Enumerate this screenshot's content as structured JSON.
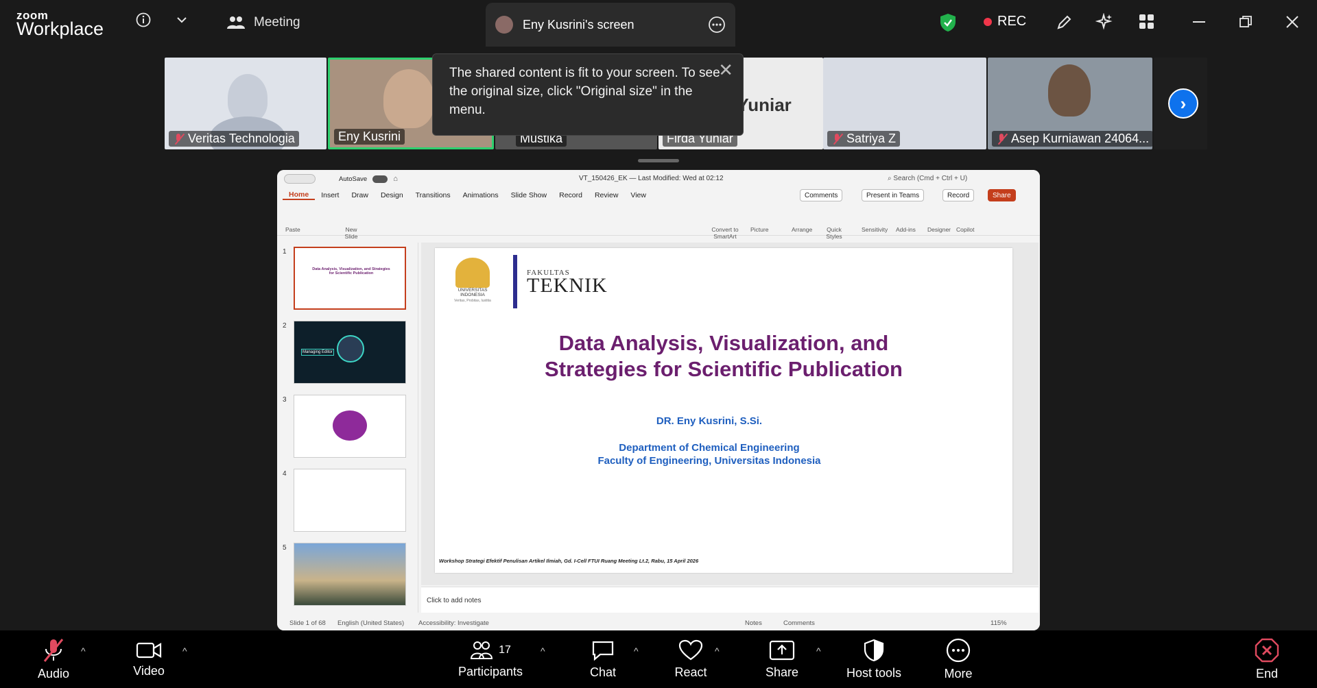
{
  "app": {
    "logo_top": "zoom",
    "logo_bottom": "Workplace"
  },
  "topbar": {
    "meeting_label": "Meeting",
    "screen_tab_label": "Eny Kusrini's screen",
    "rec_label": "REC"
  },
  "tooltip": {
    "text": "The shared content is fit to your screen. To see the original size, click \"Original size\" in the menu."
  },
  "participants_strip": [
    {
      "name": "Veritas Technologia"
    },
    {
      "name": "Eny Kusrini"
    },
    {
      "name": "Mustika"
    },
    {
      "name": "Firda Yuniar"
    },
    {
      "name": "Satriya Z"
    },
    {
      "name": "Asep Kurniawan 24064..."
    }
  ],
  "firda_big_name": "Firda Yuniar",
  "ppt": {
    "autosave": "AutoSave",
    "file_name": "VT_150426_EK",
    "last_modified": "— Last Modified: Wed at 02:12",
    "search": "Search (Cmd + Ctrl + U)",
    "menu": [
      "Home",
      "Insert",
      "Draw",
      "Design",
      "Transitions",
      "Animations",
      "Slide Show",
      "Record",
      "Review",
      "View"
    ],
    "buttons": {
      "comments": "Comments",
      "present_in_teams": "Present in Teams",
      "record": "Record",
      "share": "Share"
    },
    "ribbon": {
      "paste": "Paste",
      "new_slide": "New Slide",
      "convert": "Convert to SmartArt",
      "picture": "Picture",
      "arrange": "Arrange",
      "quick_styles": "Quick Styles",
      "sensitivity": "Sensitivity",
      "addins": "Add-ins",
      "designer": "Designer",
      "copilot": "Copilot"
    },
    "slide_numbers": [
      "1",
      "2",
      "3",
      "4",
      "5"
    ],
    "thumb2_text": "Managing Editor",
    "thumb1_title": "Data Analysis, Visualization, and Strategies for Scientific Publication",
    "slide": {
      "faculty_small": "FAKULTAS",
      "faculty_big": "TEKNIK",
      "univ": "UNIVERSITAS INDONESIA",
      "univ_motto": "Veritas, Probitas, Iustitia",
      "title_line1": "Data Analysis, Visualization, and",
      "title_line2": "Strategies for Scientific Publication",
      "author": "DR. Eny Kusrini, S.Si.",
      "dept_line1": "Department of Chemical Engineering",
      "dept_line2": "Faculty of Engineering, Universitas Indonesia",
      "footer": "Workshop Strategi Efektif Penulisan Artikel Ilmiah, Gd. I-Cell FTUI Ruang Meeting Lt.2, Rabu, 15 April 2026"
    },
    "notes_placeholder": "Click to add notes",
    "status": {
      "slide_count": "Slide 1 of 68",
      "language": "English (United States)",
      "accessibility": "Accessibility: Investigate",
      "notes": "Notes",
      "comments": "Comments",
      "zoom": "115%"
    }
  },
  "bottombar": {
    "audio": "Audio",
    "video": "Video",
    "participants": "Participants",
    "participants_count": "17",
    "chat": "Chat",
    "react": "React",
    "share": "Share",
    "host_tools": "Host tools",
    "more": "More",
    "end": "End"
  },
  "colors": {
    "accent_blue": "#0e72ed",
    "title_purple": "#6b1f6e",
    "dept_blue": "#1f5fbf",
    "rec_red": "#f0364a",
    "shield_green": "#22b14c"
  }
}
